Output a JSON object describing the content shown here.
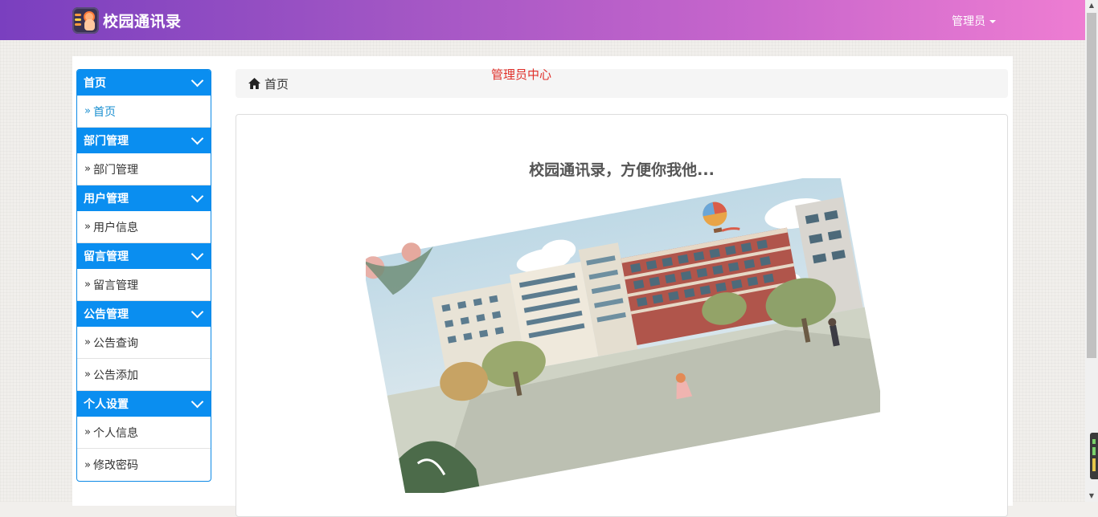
{
  "navbar": {
    "brand_title": "校园通讯录",
    "admin_label": "管理员",
    "gradient_start": "#7a3fbf",
    "gradient_end": "#ee7dd2"
  },
  "center_label": "管理员中心",
  "breadcrumb": {
    "icon": "home-icon",
    "label": "首页"
  },
  "sidebar": {
    "accent": "#0a8ef0",
    "groups": [
      {
        "title": "首页",
        "items": [
          {
            "label": "首页",
            "active": true
          }
        ]
      },
      {
        "title": "部门管理",
        "items": [
          {
            "label": "部门管理"
          }
        ]
      },
      {
        "title": "用户管理",
        "items": [
          {
            "label": "用户信息"
          }
        ]
      },
      {
        "title": "留言管理",
        "items": [
          {
            "label": "留言管理"
          }
        ]
      },
      {
        "title": "公告管理",
        "items": [
          {
            "label": "公告查询"
          },
          {
            "label": "公告添加"
          }
        ]
      },
      {
        "title": "个人设置",
        "items": [
          {
            "label": "个人信息"
          },
          {
            "label": "修改密码"
          }
        ]
      }
    ]
  },
  "content": {
    "slogan": "校园通讯录，方便你我他..."
  }
}
